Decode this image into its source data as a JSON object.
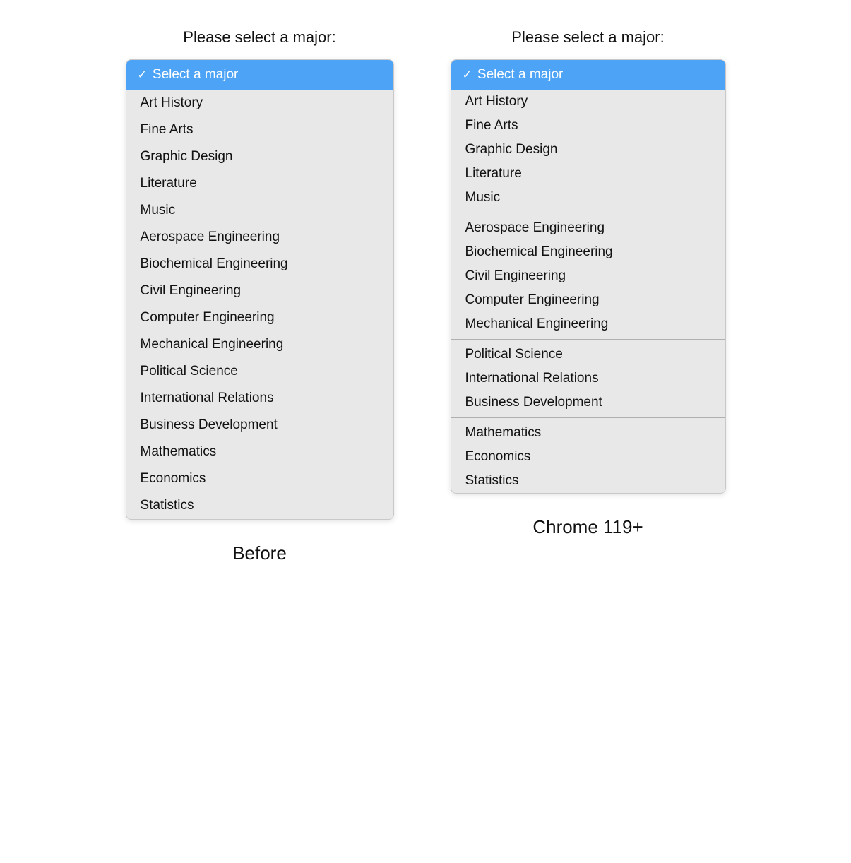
{
  "before": {
    "label": "Please select a major:",
    "caption": "Before",
    "selected": "Select a major",
    "options": [
      "Art History",
      "Fine Arts",
      "Graphic Design",
      "Literature",
      "Music",
      "Aerospace Engineering",
      "Biochemical Engineering",
      "Civil Engineering",
      "Computer Engineering",
      "Mechanical Engineering",
      "Political Science",
      "International Relations",
      "Business Development",
      "Mathematics",
      "Economics",
      "Statistics"
    ]
  },
  "after": {
    "label": "Please select a major:",
    "caption": "Chrome 119+",
    "selected": "Select a major",
    "groups": [
      {
        "items": [
          "Art History",
          "Fine Arts",
          "Graphic Design",
          "Literature",
          "Music"
        ]
      },
      {
        "items": [
          "Aerospace Engineering",
          "Biochemical Engineering",
          "Civil Engineering",
          "Computer Engineering",
          "Mechanical Engineering"
        ]
      },
      {
        "items": [
          "Political Science",
          "International Relations",
          "Business Development"
        ]
      },
      {
        "items": [
          "Mathematics",
          "Economics",
          "Statistics"
        ]
      }
    ]
  }
}
